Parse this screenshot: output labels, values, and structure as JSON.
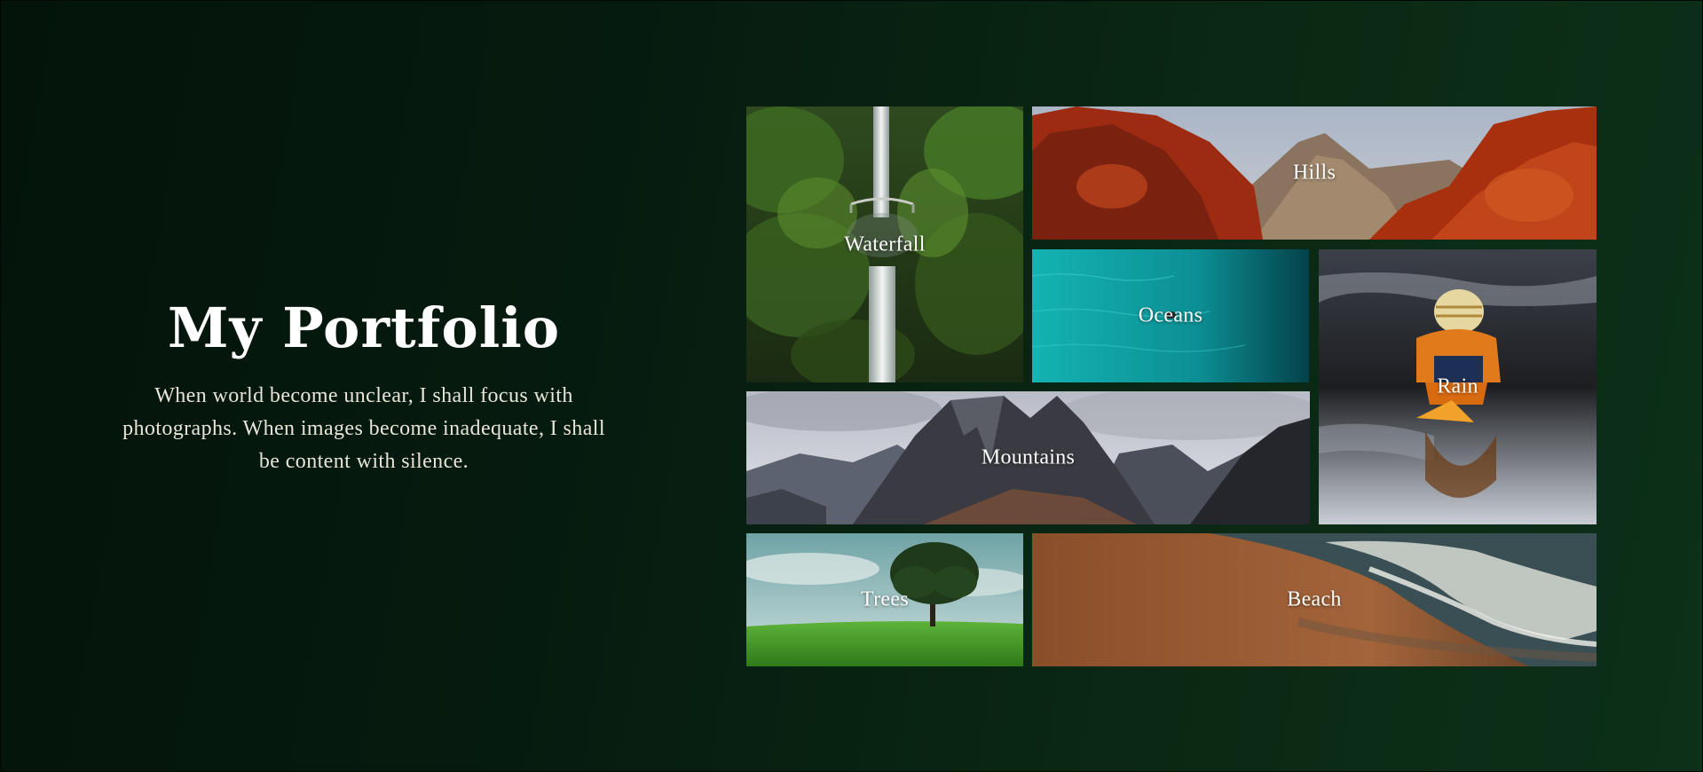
{
  "header": {
    "title": "My Portfolio",
    "tagline": "When world become unclear, I shall focus with photographs. When images become inadequate, I shall be content with silence."
  },
  "gallery": {
    "items": [
      {
        "label": "Waterfall"
      },
      {
        "label": "Hills"
      },
      {
        "label": "Oceans"
      },
      {
        "label": "Rain"
      },
      {
        "label": "Mountains"
      },
      {
        "label": "Trees"
      },
      {
        "label": "Beach"
      }
    ]
  },
  "colors": {
    "background_dark": "#04140b",
    "background_light": "#0d3019",
    "title_text": "#ffffff",
    "body_text": "#e8e4d8"
  }
}
